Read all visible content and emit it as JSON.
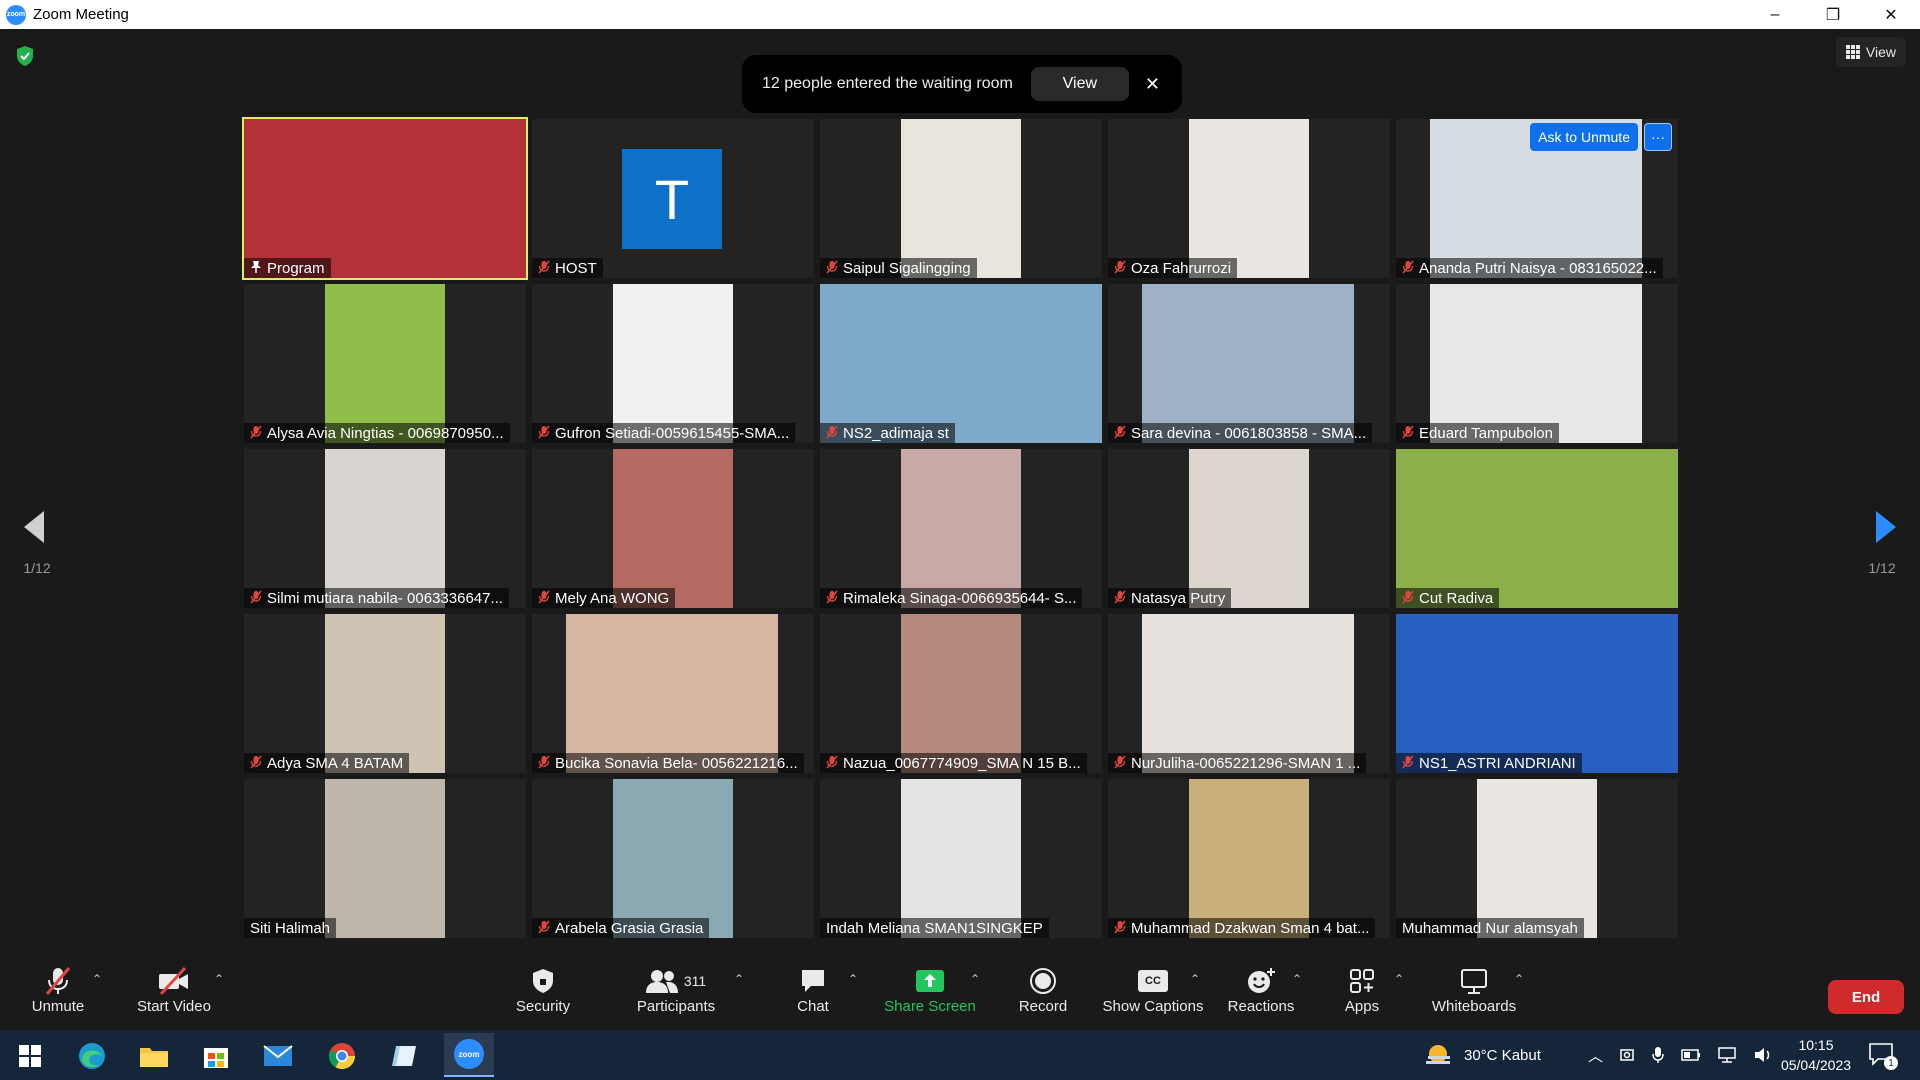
{
  "window": {
    "title": "Zoom Meeting",
    "app_icon_label": "zoom",
    "controls": [
      "–",
      "❐",
      "✕"
    ]
  },
  "top_view_button": {
    "label": "View"
  },
  "toast": {
    "message": "12 people entered the waiting room",
    "view_label": "View",
    "close_label": "✕"
  },
  "pagination": {
    "left": "1/12",
    "right": "1/12"
  },
  "tiles": [
    {
      "name": "Program",
      "icon": "pin",
      "bg": "#8a1e1e",
      "video_color": "#b3323a"
    },
    {
      "name": "HOST",
      "icon": "mic-off",
      "avatar_letter": "T"
    },
    {
      "name": "Saipul Sigalingging",
      "icon": "mic-off",
      "video_color": "#e9e4dc"
    },
    {
      "name": "Oza Fahrurrozi",
      "icon": "mic-off",
      "video_color": "#eae6e1"
    },
    {
      "name": "Ananda Putri Naisya - 083165022...",
      "icon": "mic-off",
      "video_color": "#d6dde3",
      "ask_to_unmute": "Ask to Unmute",
      "more": "···"
    },
    {
      "name": "Alysa Avia Ningtias - 0069870950...",
      "icon": "mic-off",
      "video_color": "#8fbf4a"
    },
    {
      "name": "Gufron Setiadi-0059615455-SMA...",
      "icon": "mic-off",
      "video_color": "#f1f1f1"
    },
    {
      "name": "NS2_adimaja st",
      "icon": "mic-off",
      "video_color": "#7fa9c9"
    },
    {
      "name": "Sara devina - 0061803858 - SMA...",
      "icon": "mic-off",
      "video_color": "#9fb1c6"
    },
    {
      "name": "Eduard Tampubolon",
      "icon": "mic-off",
      "video_color": "#e8e8ea"
    },
    {
      "name": "Silmi mutiara nabila- 0063336647...",
      "icon": "mic-off",
      "video_color": "#d9d6d2"
    },
    {
      "name": "Mely Ana WONG",
      "icon": "mic-off",
      "video_color": "#b46a62"
    },
    {
      "name": "Rimaleka Sinaga-0066935644- S...",
      "icon": "mic-off",
      "video_color": "#c7a9a8"
    },
    {
      "name": "Natasya Putry",
      "icon": "mic-off",
      "video_color": "#dcd6cf"
    },
    {
      "name": "Cut Radiva",
      "icon": "mic-off",
      "video_color": "#8bb04a"
    },
    {
      "name": "Adya SMA 4 BATAM",
      "icon": "mic-off",
      "video_color": "#cfc4b3"
    },
    {
      "name": "Bucika Sonavia Bela- 0056221216...",
      "icon": "mic-off",
      "video_color": "#d7b7a4"
    },
    {
      "name": "Nazua_0067774909_SMA N 15 B...",
      "icon": "mic-off",
      "video_color": "#b58a7c"
    },
    {
      "name": "NurJuliha-0065221296-SMAN 1 ...",
      "icon": "mic-off",
      "video_color": "#e6e1dc"
    },
    {
      "name": "NS1_ASTRI ANDRIANI",
      "icon": "mic-off",
      "video_color": "#2a5fc2"
    },
    {
      "name": "Siti Halimah",
      "icon": "none",
      "video_color": "#bfb7ab"
    },
    {
      "name": "Arabela Grasia Grasia",
      "icon": "mic-off",
      "video_color": "#8aa9b3"
    },
    {
      "name": "Indah Meliana SMAN1SINGKEP",
      "icon": "none",
      "video_color": "#e3e3e3"
    },
    {
      "name": "Muhammad Dzakwan Sman 4 bat...",
      "icon": "mic-off",
      "video_color": "#c9b07a"
    },
    {
      "name": "Muhammad Nur alamsyah",
      "icon": "none",
      "video_color": "#e9e5e1"
    }
  ],
  "toolbar": {
    "unmute": "Unmute",
    "start_video": "Start Video",
    "security": "Security",
    "participants": "Participants",
    "participants_count": "311",
    "chat": "Chat",
    "share_screen": "Share Screen",
    "record": "Record",
    "show_captions": "Show Captions",
    "captions_badge": "CC",
    "reactions": "Reactions",
    "apps": "Apps",
    "whiteboards": "Whiteboards",
    "end": "End"
  },
  "taskbar": {
    "weather": "30°C  Kabut",
    "time": "10:15",
    "date": "05/04/2023",
    "notifications": "1",
    "zoom_label": "zoom"
  },
  "colors": {
    "accent": "#0e71eb",
    "end": "#d12a2a",
    "share": "#22c55e",
    "active_border": "#d9f06a"
  }
}
